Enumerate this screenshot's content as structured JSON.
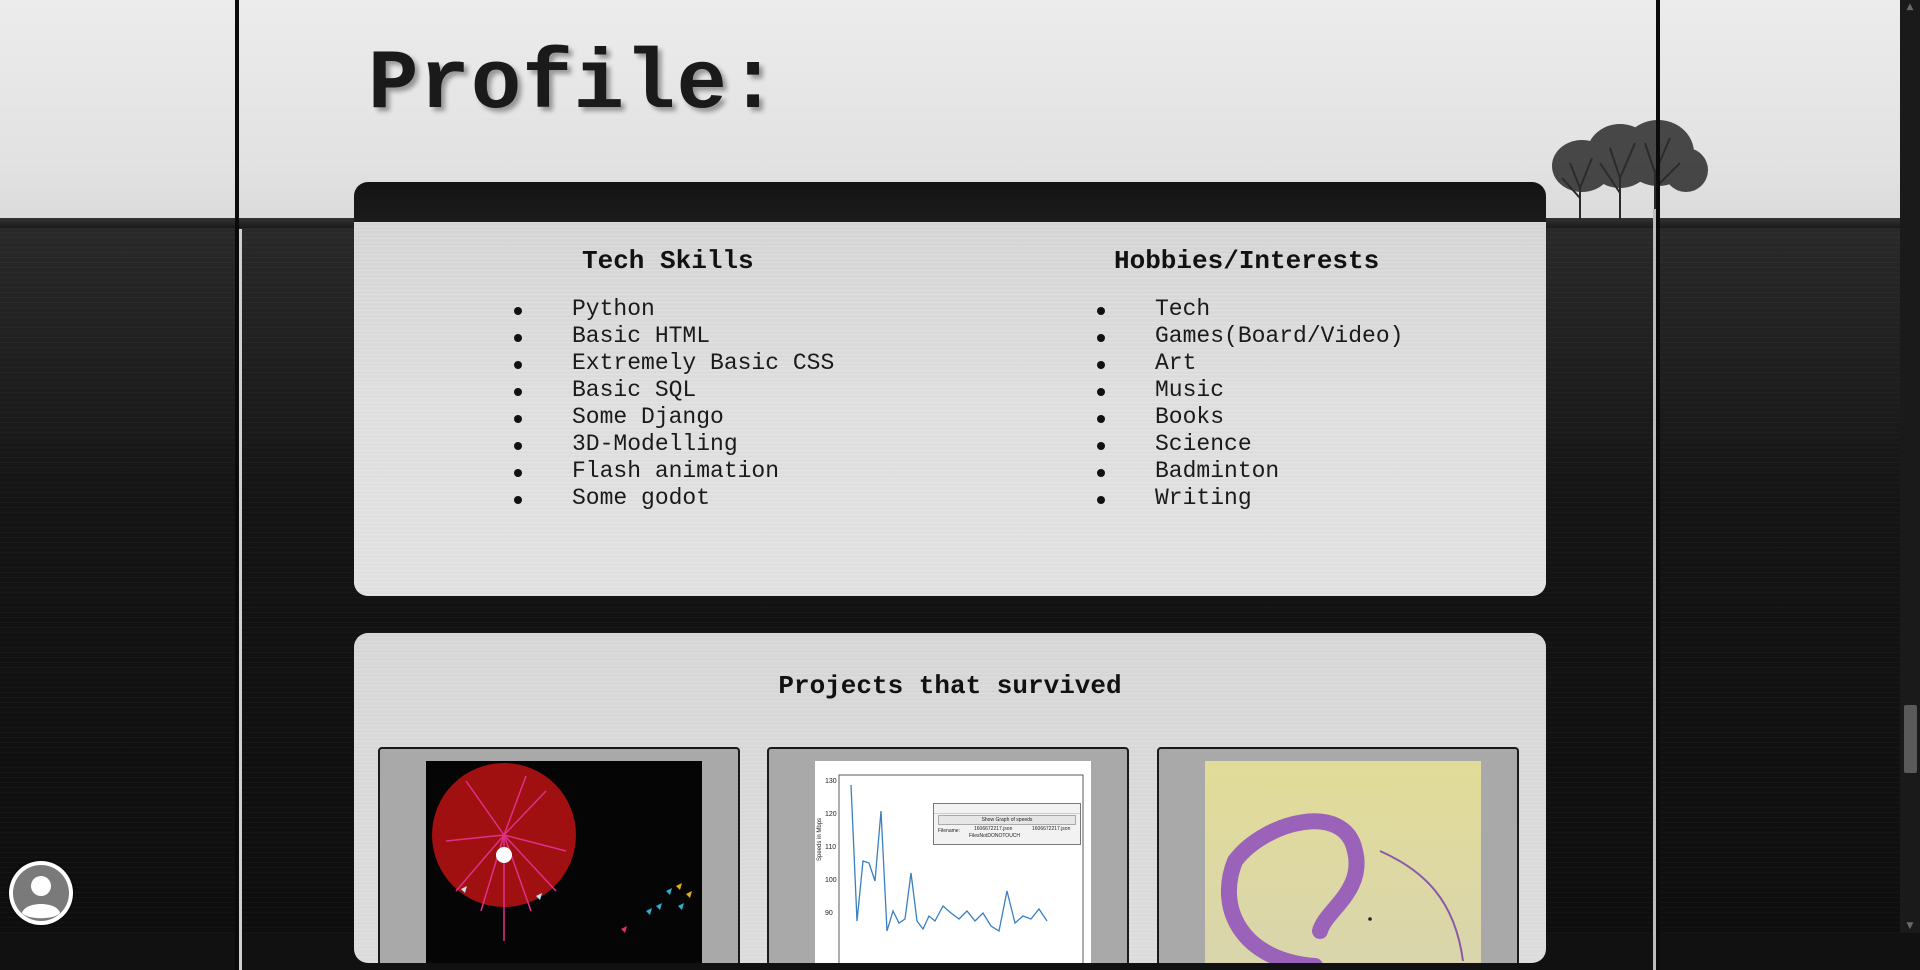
{
  "page": {
    "title": "Profile:"
  },
  "skills": {
    "heading": "Tech Skills",
    "items": [
      "Python",
      "Basic HTML",
      "Extremely Basic CSS",
      "Basic SQL",
      "Some Django",
      "3D-Modelling",
      "Flash animation",
      "Some godot"
    ]
  },
  "hobbies": {
    "heading": "Hobbies/Interests",
    "items": [
      "Tech",
      "Games(Board/Video)",
      "Art",
      "Music",
      "Books",
      "Science",
      "Badminton",
      "Writing"
    ]
  },
  "projects": {
    "heading": "Projects that survived",
    "tiles": [
      {
        "icon": "spinning-wheel-game-image"
      },
      {
        "icon": "speed-graph-screenshot-image"
      },
      {
        "icon": "purple-drawing-image"
      }
    ]
  },
  "graph_window": {
    "button": "Show Graph of speeds",
    "filename_label": "Filename:",
    "filename_value_1": "1606672217.json",
    "filename_value_2": "1606672217.json",
    "filename_value_3": "FilesNotDONOTOUCH",
    "y_axis_label": "Speeds in Mbps",
    "y_ticks": [
      "130",
      "120",
      "110",
      "100",
      "90"
    ]
  },
  "colors": {
    "card_dark": "#141414",
    "card_light": "#dcdcdc",
    "wheel_red": "#a01010",
    "accent_pink": "#e0308a",
    "drawing_purple": "#9a62b8"
  },
  "avatar": {
    "icon": "user-avatar-icon"
  }
}
